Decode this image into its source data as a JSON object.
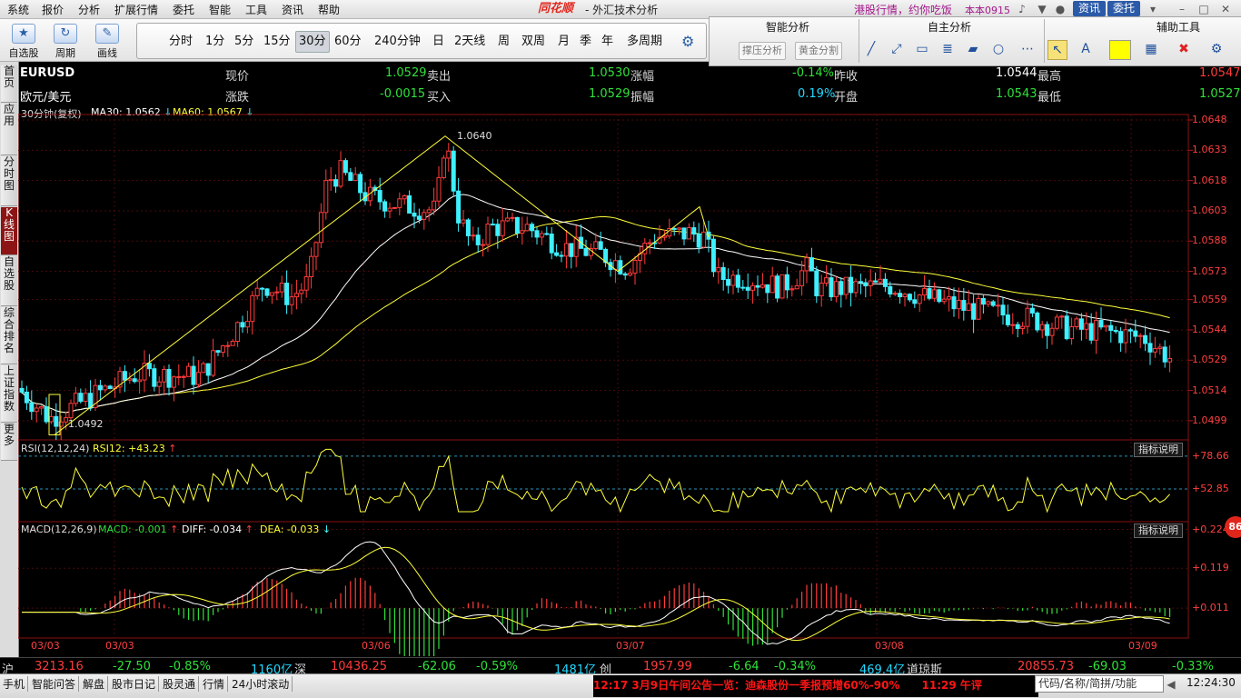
{
  "menu": {
    "items": [
      "系统",
      "报价",
      "分析",
      "扩展行情",
      "委托",
      "智能",
      "工具",
      "资讯",
      "帮助"
    ]
  },
  "brand": {
    "logo": "同花顺",
    "title": "- 外汇技术分析",
    "promo": "港股行情，约你吃饭",
    "version": "本本0915",
    "news_btn": "资讯",
    "trade_btn": "委托"
  },
  "toolbar": {
    "buttons": [
      {
        "label": "自选股",
        "icon": "star-icon"
      },
      {
        "label": "周期",
        "icon": "cycle-icon"
      },
      {
        "label": "画线",
        "icon": "pen-icon"
      }
    ],
    "periods": [
      "分时",
      "1分",
      "5分",
      "15分",
      "30分",
      "60分",
      "240分钟",
      "日",
      "2天线",
      "周",
      "双周",
      "月",
      "季",
      "年",
      "多周期"
    ],
    "selected_period": "30分"
  },
  "rpanel": {
    "smart": "智能分析",
    "custom": "自主分析",
    "aux": "辅助工具",
    "btn1": "撑压分析",
    "btn2": "黄金分割"
  },
  "sidetabs": [
    "首页",
    "应用",
    "分时图",
    "K线图",
    "自选股",
    "综合排名",
    "上证指数",
    "更多"
  ],
  "quote": {
    "symbol": "EURUSD",
    "name": "欧元/美元",
    "labels": [
      "现价",
      "卖出",
      "涨幅",
      "昨收",
      "最高",
      "涨跌",
      "买入",
      "振幅",
      "开盘",
      "最低"
    ],
    "values": {
      "price": "1.0529",
      "sell": "1.0530",
      "change_pct": "-0.14%",
      "prev_close": "1.0544",
      "high": "1.0547",
      "change": "-0.0015",
      "buy": "1.0529",
      "amplitude": "0.19%",
      "open": "1.0543",
      "low": "1.0527"
    }
  },
  "chart_legend": {
    "period_label": "30分钟(复权)",
    "ma30": "MA30: 1.0562",
    "ma60": "MA60: 1.0567"
  },
  "chart_data": {
    "type": "candlestick",
    "price_axis": [
      "1.0648",
      "1.0633",
      "1.0618",
      "1.0603",
      "1.0588",
      "1.0573",
      "1.0559",
      "1.0544",
      "1.0529",
      "1.0514",
      "1.0499"
    ],
    "price_range": [
      1.0485,
      1.0648
    ],
    "annotations": {
      "high": "1.0640",
      "low": "1.0492"
    },
    "date_labels": [
      "03/03",
      "03/03",
      "03/06",
      "03/07",
      "03/08",
      "03/09"
    ],
    "rsi": {
      "title": "RSI(12,12,24)",
      "value": "RSI12: +43.23",
      "axis": [
        "+78.66",
        "+52.85"
      ],
      "range": [
        30,
        90
      ]
    },
    "macd": {
      "title": "MACD(12,26,9)",
      "macd": "MACD: -0.001",
      "diff": "DIFF: -0.034",
      "dea": "DEA: -0.033",
      "axis": [
        "+0.224",
        "+0.119",
        "+0.011"
      ],
      "range": [
        -0.06,
        0.24
      ]
    },
    "indicator_btn": "指标说明"
  },
  "status": {
    "sh_label": "沪",
    "sh_val": "3213.16",
    "sh_chg": "-27.50",
    "sh_pct": "-0.85%",
    "sh_amt": "1160亿",
    "sz_label": "深",
    "sz_val": "10436.25",
    "sz_chg": "-62.06",
    "sz_pct": "-0.59%",
    "sz_amt": "1481亿",
    "cy_label": "创",
    "cy_val": "1957.99",
    "cy_chg": "-6.64",
    "cy_pct": "-0.34%",
    "cy_amt": "469.4亿",
    "dj_label": "道琼斯",
    "dj_val": "20855.73",
    "dj_chg": "-69.03",
    "dj_pct": "-0.33%"
  },
  "bottom": {
    "buttons": [
      "手机",
      "智能问答",
      "解盘",
      "股市日记",
      "股灵通",
      "行情",
      "24小时滚动"
    ],
    "news": "12:17 3月9日午间公告一览：迪森股份一季报预增60%-90%　　11:29 午评",
    "search_placeholder": "代码/名称/简拼/功能",
    "clock": "12:24:30",
    "badge": "86"
  }
}
